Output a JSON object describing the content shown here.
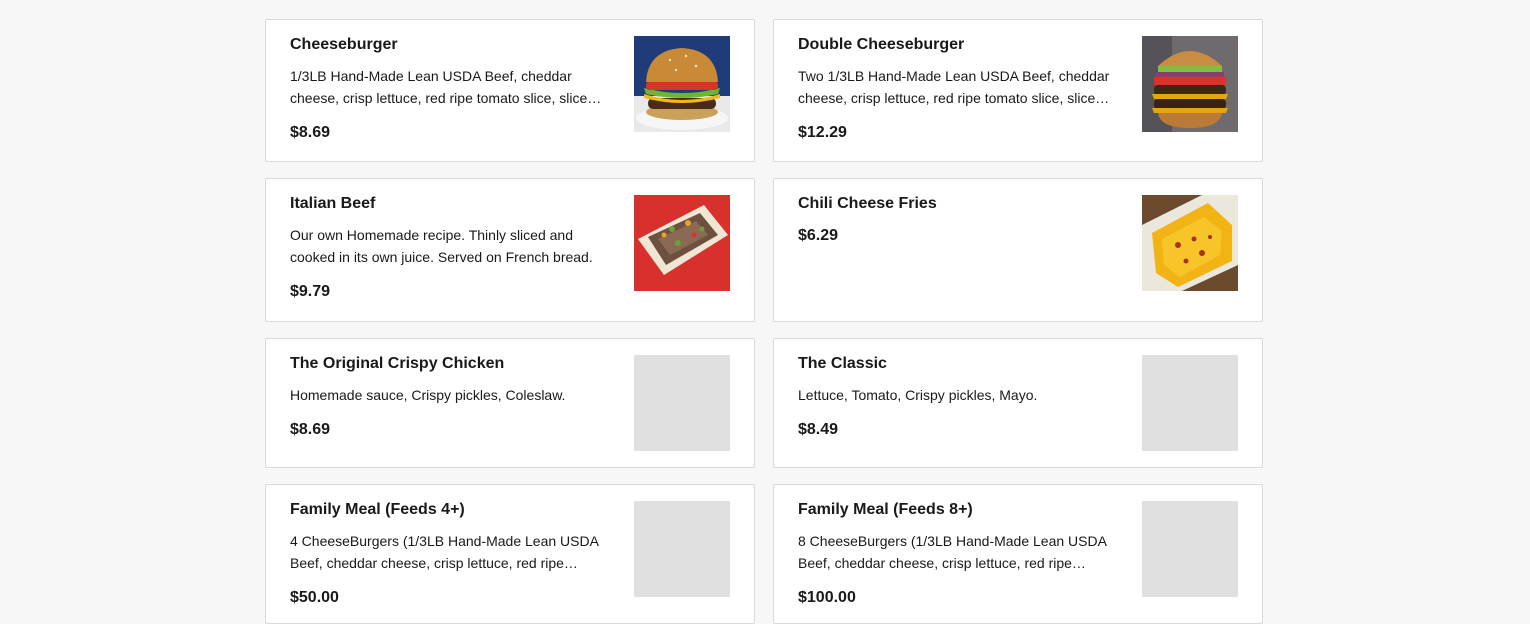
{
  "menu": {
    "items": [
      {
        "name": "Cheeseburger",
        "description": "1/3LB Hand-Made Lean USDA Beef, cheddar cheese, crisp lettuce, red ripe tomato slice, slice…",
        "price": "$8.69",
        "image": "cheeseburger-photo"
      },
      {
        "name": "Double Cheeseburger",
        "description": "Two 1/3LB Hand-Made Lean USDA Beef, cheddar cheese, crisp lettuce, red ripe tomato slice, slice…",
        "price": "$12.29",
        "image": "double-cheeseburger-photo"
      },
      {
        "name": "Italian Beef",
        "description": "Our own Homemade recipe. Thinly sliced and cooked in its own juice. Served on French bread.",
        "price": "$9.79",
        "image": "italian-beef-photo"
      },
      {
        "name": "Chili Cheese Fries",
        "description": "",
        "price": "$6.29",
        "image": "chili-cheese-fries-photo"
      },
      {
        "name": "The Original Crispy Chicken",
        "description": "Homemade sauce, Crispy pickles, Coleslaw.",
        "price": "$8.69",
        "image": "placeholder"
      },
      {
        "name": "The Classic",
        "description": "Lettuce, Tomato, Crispy pickles, Mayo.",
        "price": "$8.49",
        "image": "placeholder"
      },
      {
        "name": "Family Meal (Feeds 4+)",
        "description": "4 CheeseBurgers (1/3LB Hand-Made Lean USDA Beef, cheddar cheese, crisp lettuce, red ripe…",
        "price": "$50.00",
        "image": "placeholder"
      },
      {
        "name": "Family Meal (Feeds 8+)",
        "description": "8 CheeseBurgers (1/3LB Hand-Made Lean USDA Beef, cheddar cheese, crisp lettuce, red ripe…",
        "price": "$100.00",
        "image": "placeholder"
      }
    ]
  },
  "colors": {
    "background": "#f7f7f7",
    "card": "#ffffff",
    "border": "#d9d9d9",
    "placeholder": "#e0e0e0",
    "text": "#191919"
  }
}
